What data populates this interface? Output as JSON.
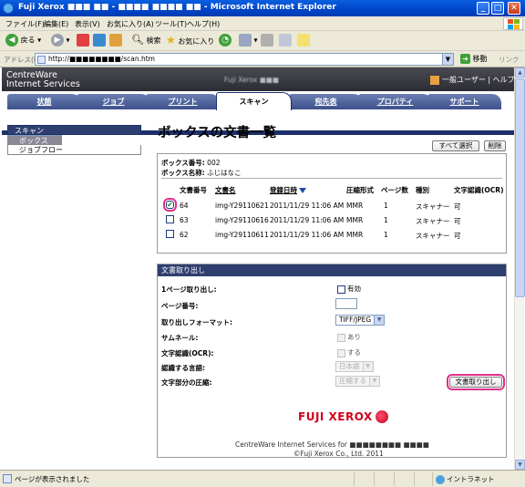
{
  "window": {
    "title": "Fuji Xerox ■■■ ■■ - ■■■■ ■■■■ ■■ - Microsoft Internet Explorer"
  },
  "menu": [
    "ファイル(F)",
    "編集(E)",
    "表示(V)",
    "お気に入り(A)",
    "ツール(T)",
    "ヘルプ(H)"
  ],
  "toolbar": {
    "back": "戻る",
    "search": "検索",
    "favorites": "お気に入り"
  },
  "address": {
    "label": "アドレス(D)",
    "url": "http://■■■■■■■■/scan.htm",
    "go": "移動",
    "links": "リンク"
  },
  "header": {
    "brand_line1": "CentreWare",
    "brand_line2": "Internet Services",
    "model": "Fuji Xerox ■■■",
    "user": "一般ユーザー | ヘルプ..."
  },
  "tabs": [
    "状態",
    "ジョブ",
    "プリント",
    "スキャン",
    "宛先表",
    "プロパティ",
    "サポート"
  ],
  "nav": {
    "heading": "スキャン",
    "items": [
      "ボックス",
      "ジョブフロー"
    ]
  },
  "main": {
    "title": "ボックスの文書一覧",
    "select_all": "すべて選択",
    "delete": "削除",
    "box_number_label": "ボックス番号:",
    "box_number": "002",
    "box_name_label": "ボックス名称:",
    "box_name": "ふじはなこ"
  },
  "table": {
    "headers": [
      "文書番号",
      "文書名",
      "登録日時",
      "圧縮形式",
      "ページ数",
      "種別",
      "文字認識(OCR)"
    ],
    "rows": [
      {
        "checked": true,
        "no": "64",
        "name": "img-Y29110621",
        "date": "2011/11/29 11:06 AM",
        "format": "MMR",
        "pages": "1",
        "type": "スキャナー",
        "ocr": "可"
      },
      {
        "checked": false,
        "no": "63",
        "name": "img-Y29110616",
        "date": "2011/11/29 11:06 AM",
        "format": "MMR",
        "pages": "1",
        "type": "スキャナー",
        "ocr": "可"
      },
      {
        "checked": false,
        "no": "62",
        "name": "img-Y29110611",
        "date": "2011/11/29 11:06 AM",
        "format": "MMR",
        "pages": "1",
        "type": "スキャナー",
        "ocr": "可"
      }
    ]
  },
  "retrieve": {
    "heading": "文書取り出し",
    "single_page_label": "1ページ取り出し:",
    "single_page_opt": "有効",
    "page_number_label": "ページ番号:",
    "format_label": "取り出しフォーマット:",
    "format_value": "TIFF/JPEG",
    "thumbnail_label": "サムネール:",
    "thumbnail_opt": "あり",
    "ocr_label": "文字認識(OCR):",
    "ocr_opt": "する",
    "language_label": "認識する言語:",
    "language_value": "日本語",
    "compress_label": "文字部分の圧縮:",
    "compress_value": "圧縮する",
    "button": "文書取り出し"
  },
  "footer": {
    "logo": "FUJI XEROX",
    "line1": "CentreWare Internet Services for ■■■■■■■■ ■■■■",
    "line2": "©Fuji Xerox Co., Ltd. 2011"
  },
  "statusbar": {
    "text": "ページが表示されました",
    "zone": "イントラネット"
  },
  "colors": {
    "highlight": "#e0308a",
    "nav_dark": "#2e3f6f",
    "brand_red": "#d0021b"
  }
}
